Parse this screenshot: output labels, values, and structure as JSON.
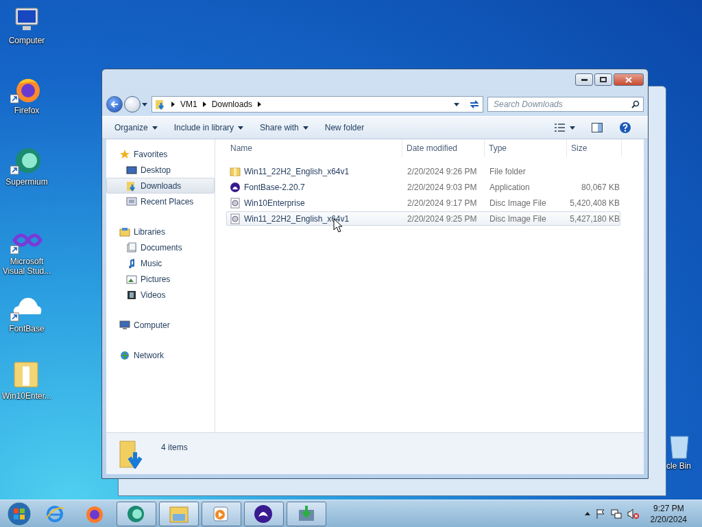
{
  "desktop_icons": [
    {
      "label": "Computer",
      "kind": "computer",
      "shortcut": false
    },
    {
      "label": "Firefox",
      "kind": "firefox",
      "shortcut": true
    },
    {
      "label": "Supermium",
      "kind": "supermium",
      "shortcut": true
    },
    {
      "label": "Microsoft Visual Stud...",
      "kind": "visualstudio",
      "shortcut": true
    },
    {
      "label": "FontBase",
      "kind": "fontbase",
      "shortcut": true
    },
    {
      "label": "Win10Enter...",
      "kind": "zipfolder",
      "shortcut": false
    }
  ],
  "recycle_bin": {
    "label": "cle Bin"
  },
  "window": {
    "address": [
      "VM1",
      "Downloads"
    ],
    "search": {
      "placeholder": "Search Downloads"
    },
    "toolbar": [
      {
        "label": "Organize",
        "dropdown": true
      },
      {
        "label": "Include in library",
        "dropdown": true
      },
      {
        "label": "Share with",
        "dropdown": true
      },
      {
        "label": "New folder",
        "dropdown": false
      }
    ],
    "nav": [
      {
        "label": "Favorites",
        "kind": "star",
        "selected": false,
        "children": [
          {
            "label": "Desktop",
            "kind": "desktop",
            "selected": false
          },
          {
            "label": "Downloads",
            "kind": "downloads",
            "selected": true
          },
          {
            "label": "Recent Places",
            "kind": "recent",
            "selected": false
          }
        ]
      },
      {
        "label": "Libraries",
        "kind": "libraries",
        "selected": false,
        "children": [
          {
            "label": "Documents",
            "kind": "documents",
            "selected": false
          },
          {
            "label": "Music",
            "kind": "music",
            "selected": false
          },
          {
            "label": "Pictures",
            "kind": "pictures",
            "selected": false
          },
          {
            "label": "Videos",
            "kind": "videos",
            "selected": false
          }
        ]
      },
      {
        "label": "Computer",
        "kind": "computer",
        "selected": false
      },
      {
        "label": "Network",
        "kind": "network",
        "selected": false
      }
    ],
    "columns": [
      "Name",
      "Date modified",
      "Type",
      "Size"
    ],
    "rows": [
      {
        "name": "Win11_22H2_English_x64v1",
        "kind": "folder",
        "date": "2/20/2024 9:26 PM",
        "type": "File folder",
        "selected": false
      },
      {
        "name": "FontBase-2.20.7",
        "kind": "app",
        "date": "2/20/2024 9:03 PM",
        "type": "Application",
        "size": "80,067 KB",
        "selected": false
      },
      {
        "name": "Win10Enterprise",
        "kind": "disc",
        "date": "2/20/2024 9:17 PM",
        "type": "Disc Image File",
        "size": "5,420,408 KB",
        "selected": false
      },
      {
        "name": "Win11_22H2_English_x64v1",
        "kind": "disc",
        "date": "2/20/2024 9:25 PM",
        "type": "Disc Image File",
        "size": "5,427,180 KB",
        "selected": true
      }
    ],
    "status": "4 items"
  },
  "taskbar": {
    "items": [
      {
        "kind": "ie",
        "open": false,
        "active": false
      },
      {
        "kind": "firefox",
        "open": false,
        "active": false
      },
      {
        "kind": "supermium",
        "open": true,
        "active": false
      },
      {
        "kind": "explorer",
        "open": true,
        "active": true
      },
      {
        "kind": "media",
        "open": true,
        "active": false
      },
      {
        "kind": "fontbase",
        "open": true,
        "active": false
      },
      {
        "kind": "installer",
        "open": true,
        "active": false
      }
    ],
    "time": "9:27 PM",
    "date": "2/20/2024"
  }
}
